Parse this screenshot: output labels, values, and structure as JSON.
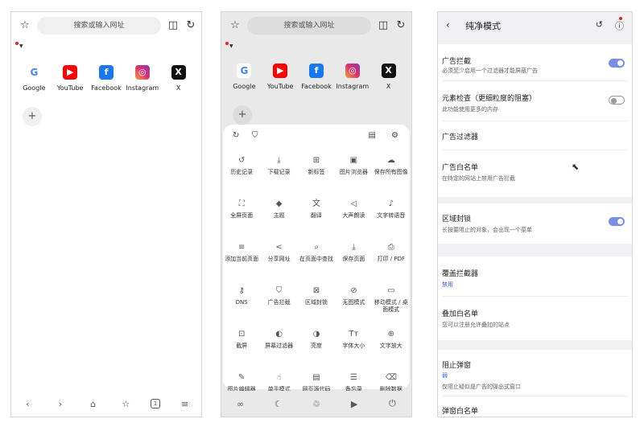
{
  "browser": {
    "url_placeholder": "搜索或输入网址",
    "shortcuts": [
      {
        "icon": "google-logo",
        "glyph": "G",
        "label": "Google"
      },
      {
        "icon": "youtube-logo",
        "glyph": "▶",
        "label": "YouTube"
      },
      {
        "icon": "facebook-logo",
        "glyph": "f",
        "label": "Facebook"
      },
      {
        "icon": "instagram-logo",
        "glyph": "◎",
        "label": "Instagram"
      },
      {
        "icon": "x-logo",
        "glyph": "X",
        "label": "X"
      }
    ],
    "add_label": "+",
    "tab_count": "1"
  },
  "menu": {
    "items": [
      {
        "icon": "history-icon",
        "glyph": "↺",
        "label": "历史记录"
      },
      {
        "icon": "download-icon",
        "glyph": "⤓",
        "label": "下载记录"
      },
      {
        "icon": "new-tab-icon",
        "glyph": "⊞",
        "label": "新标签"
      },
      {
        "icon": "image-browser-icon",
        "glyph": "▣",
        "label": "图片浏览器"
      },
      {
        "icon": "save-images-icon",
        "glyph": "☁",
        "label": "保存所有图像"
      },
      {
        "icon": "fullscreen-icon",
        "glyph": "⛶",
        "label": "全屏页面"
      },
      {
        "icon": "theme-icon",
        "glyph": "◆",
        "label": "主题"
      },
      {
        "icon": "translate-icon",
        "glyph": "文",
        "label": "翻译"
      },
      {
        "icon": "read-aloud-icon",
        "glyph": "◁",
        "label": "大声朗读"
      },
      {
        "icon": "text-to-speech-icon",
        "glyph": "♪",
        "label": "文字转语音"
      },
      {
        "icon": "add-page-icon",
        "glyph": "≡",
        "label": "添加当前页面"
      },
      {
        "icon": "share-icon",
        "glyph": "<",
        "label": "分享网址"
      },
      {
        "icon": "find-in-page-icon",
        "glyph": "⌕",
        "label": "在页面中查找"
      },
      {
        "icon": "save-page-icon",
        "glyph": "⤓",
        "label": "保存页面"
      },
      {
        "icon": "print-icon",
        "glyph": "⎙",
        "label": "打印 / PDF"
      },
      {
        "icon": "dns-icon",
        "glyph": "⚷",
        "label": "DNS"
      },
      {
        "icon": "ad-block-icon",
        "glyph": "⛉",
        "label": "广告拦截"
      },
      {
        "icon": "region-block-icon",
        "glyph": "⊠",
        "label": "区域封锁"
      },
      {
        "icon": "no-image-icon",
        "glyph": "⊘",
        "label": "无图模式"
      },
      {
        "icon": "desktop-mode-icon",
        "glyph": "▭",
        "label": "移动模式 / 桌面模式"
      },
      {
        "icon": "screenshot-icon",
        "glyph": "⊡",
        "label": "截屏"
      },
      {
        "icon": "screen-filter-icon",
        "glyph": "◐",
        "label": "屏幕过滤器"
      },
      {
        "icon": "brightness-icon",
        "glyph": "◑",
        "label": "亮度"
      },
      {
        "icon": "font-size-icon",
        "glyph": "Tт",
        "label": "字体大小"
      },
      {
        "icon": "text-zoom-icon",
        "glyph": "⊕",
        "label": "文字放大"
      },
      {
        "icon": "image-editor-icon",
        "glyph": "✎",
        "label": "图片编辑器"
      },
      {
        "icon": "one-hand-icon",
        "glyph": "☝",
        "label": "单手模式"
      },
      {
        "icon": "page-source-icon",
        "glyph": "▤",
        "label": "网页源代码"
      },
      {
        "icon": "notes-icon",
        "glyph": "☰",
        "label": "备忘录"
      },
      {
        "icon": "clear-data-icon",
        "glyph": "⌫",
        "label": "删除数据"
      }
    ]
  },
  "settings": {
    "title": "纯净模式",
    "rows": [
      {
        "title": "广告拦截",
        "subtitle": "必须至少启用一个过滤器才能屏蔽广告",
        "toggle": "on"
      },
      {
        "title": "元素检查（更细粒度的阻塞）",
        "subtitle": "此功能使用更多的内存",
        "toggle": "off"
      },
      {
        "title": "广告过滤器",
        "subtitle": "",
        "toggle": "none"
      },
      {
        "title": "广告白名单",
        "subtitle": "在特定的网站上禁用广告拦截",
        "toggle": "none"
      },
      {
        "title": "区域封锁",
        "subtitle": "长按要阻止的对象，会出现一个菜单",
        "toggle": "on"
      },
      {
        "title": "覆盖拦截器",
        "value": "禁用"
      },
      {
        "title": "叠加白名单",
        "subtitle": "您可以注册允许叠加的站点"
      },
      {
        "title": "阻止弹窗",
        "value": "弱",
        "subtitle": "仅阻止疑似是广告的弹出式窗口"
      },
      {
        "title": "弹窗白名单"
      }
    ]
  }
}
